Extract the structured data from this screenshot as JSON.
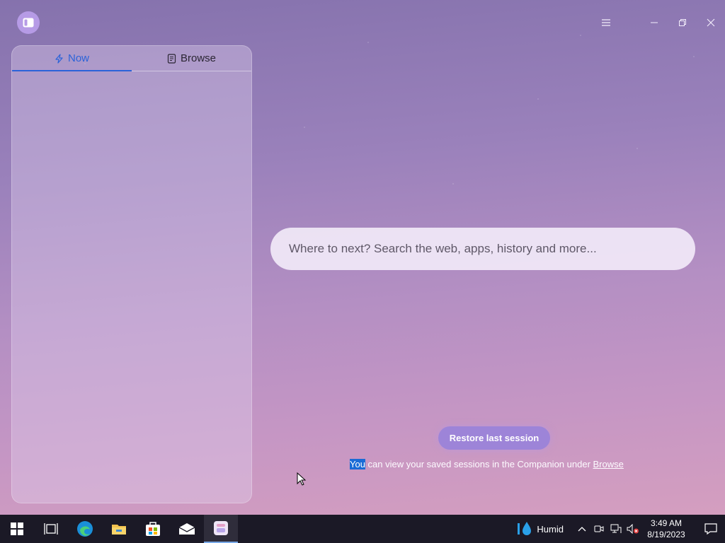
{
  "window": {
    "controls": [
      "menu-icon",
      "minimize-icon",
      "restore-icon",
      "close-icon"
    ]
  },
  "sidebar": {
    "tabs": [
      {
        "label": "Now",
        "icon": "lightning-icon",
        "active": true
      },
      {
        "label": "Browse",
        "icon": "document-icon",
        "active": false
      }
    ]
  },
  "search": {
    "placeholder": "Where to next? Search the web, apps, history and more..."
  },
  "restore": {
    "label": "Restore last session"
  },
  "note": {
    "highlighted": "You",
    "text": " can view your saved sessions in the Companion under ",
    "link": "Browse"
  },
  "taskbar": {
    "weather": "Humid",
    "time": "3:49 AM",
    "date": "8/19/2023",
    "accent": "#2b63d9"
  }
}
